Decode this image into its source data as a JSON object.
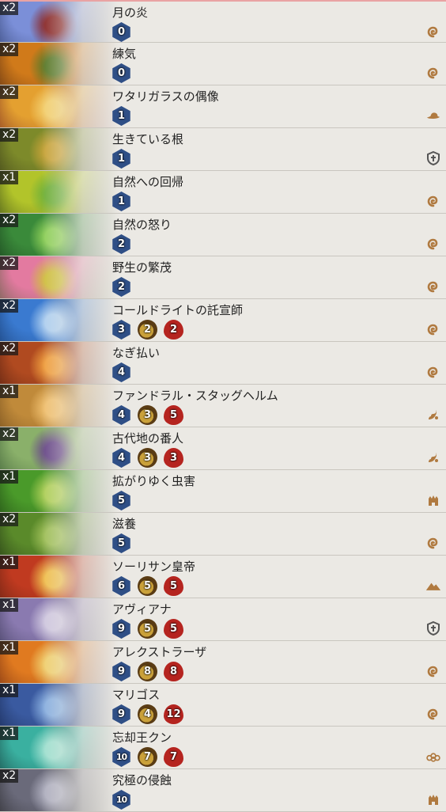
{
  "cards": [
    {
      "count": "x2",
      "name": "月の炎",
      "mana": "0",
      "attack": "",
      "health": "",
      "rarity": "free",
      "set_icon": "swirl-set-icon",
      "art": [
        "#1d2c55",
        "#7b8fd8",
        "#8b2a2a"
      ]
    },
    {
      "count": "x2",
      "name": "練気",
      "mana": "0",
      "attack": "",
      "health": "",
      "rarity": "free",
      "set_icon": "swirl-set-icon",
      "art": [
        "#3b1a10",
        "#d07a1a",
        "#5a7a2a"
      ]
    },
    {
      "count": "x2",
      "name": "ワタリガラスの偶像",
      "mana": "1",
      "attack": "",
      "health": "",
      "rarity": "free",
      "set_icon": "hat-set-icon",
      "art": [
        "#6a1a20",
        "#e4a030",
        "#f3d070"
      ]
    },
    {
      "count": "x2",
      "name": "生きている根",
      "mana": "1",
      "attack": "",
      "health": "",
      "rarity": "free",
      "set_icon": "shield-set-icon",
      "art": [
        "#2a2a14",
        "#7d8a2a",
        "#c9a43a"
      ]
    },
    {
      "count": "x1",
      "name": "自然への回帰",
      "mana": "1",
      "attack": "",
      "health": "",
      "rarity": "free",
      "set_icon": "swirl-set-icon",
      "art": [
        "#1f2f14",
        "#b2c42a",
        "#6fb03a"
      ]
    },
    {
      "count": "x2",
      "name": "自然の怒り",
      "mana": "2",
      "attack": "",
      "health": "",
      "rarity": "free",
      "set_icon": "swirl-set-icon",
      "art": [
        "#0f2a14",
        "#3a8a3a",
        "#8fd05a"
      ]
    },
    {
      "count": "x2",
      "name": "野生の繁茂",
      "mana": "2",
      "attack": "",
      "health": "",
      "rarity": "free",
      "set_icon": "swirl-set-icon",
      "art": [
        "#3a5a2a",
        "#e37aa0",
        "#d0c040"
      ]
    },
    {
      "count": "x2",
      "name": "コールドライトの託宣師",
      "mana": "3",
      "attack": "2",
      "health": "2",
      "rarity": "free",
      "set_icon": "swirl-set-icon",
      "art": [
        "#0e2a55",
        "#3a7ad0",
        "#b0d0f0"
      ]
    },
    {
      "count": "x2",
      "name": "なぎ払い",
      "mana": "4",
      "attack": "",
      "health": "",
      "rarity": "free",
      "set_icon": "swirl-set-icon",
      "art": [
        "#3a120c",
        "#b04a20",
        "#f0a040"
      ]
    },
    {
      "count": "x1",
      "name": "ファンドラル・スタッグヘルム",
      "mana": "4",
      "attack": "3",
      "health": "5",
      "rarity": "legendary",
      "set_icon": "dragon-set-icon",
      "art": [
        "#5a3a14",
        "#c08a3a",
        "#f0c070"
      ]
    },
    {
      "count": "x2",
      "name": "古代地の番人",
      "mana": "4",
      "attack": "3",
      "health": "3",
      "rarity": "free",
      "set_icon": "dragon-set-icon",
      "art": [
        "#2a4a2a",
        "#8ab06a",
        "#6a4a8a"
      ]
    },
    {
      "count": "x1",
      "name": "拡がりゆく虫害",
      "mana": "5",
      "attack": "",
      "health": "",
      "rarity": "free",
      "set_icon": "castle-set-icon",
      "art": [
        "#14300e",
        "#4a9a2a",
        "#b0d05a"
      ]
    },
    {
      "count": "x2",
      "name": "滋養",
      "mana": "5",
      "attack": "",
      "health": "",
      "rarity": "free",
      "set_icon": "swirl-set-icon",
      "art": [
        "#14200e",
        "#5a8a2a",
        "#a0c05a"
      ]
    },
    {
      "count": "x1",
      "name": "ソーリサン皇帝",
      "mana": "6",
      "attack": "5",
      "health": "5",
      "rarity": "legendary",
      "set_icon": "mountain-set-icon",
      "art": [
        "#4a1a0e",
        "#c03a20",
        "#f0c050"
      ]
    },
    {
      "count": "x1",
      "name": "アヴィアナ",
      "mana": "9",
      "attack": "5",
      "health": "5",
      "rarity": "legendary",
      "set_icon": "shield-set-icon",
      "art": [
        "#2a2a44",
        "#8a7ab0",
        "#d0c8e0"
      ]
    },
    {
      "count": "x1",
      "name": "アレクストラーザ",
      "mana": "9",
      "attack": "8",
      "health": "8",
      "rarity": "legendary",
      "set_icon": "swirl-set-icon",
      "art": [
        "#5a1a0e",
        "#e07a20",
        "#f0d070"
      ]
    },
    {
      "count": "x1",
      "name": "マリゴス",
      "mana": "9",
      "attack": "4",
      "health": "12",
      "rarity": "legendary",
      "set_icon": "swirl-set-icon",
      "art": [
        "#0e1a3a",
        "#3a5aa0",
        "#8ab0e0"
      ]
    },
    {
      "count": "x1",
      "name": "忘却王クン",
      "mana": "10",
      "attack": "7",
      "health": "7",
      "rarity": "legendary",
      "set_icon": "cloud-set-icon",
      "art": [
        "#0e2a2a",
        "#3ab0a0",
        "#a0e0d0"
      ]
    },
    {
      "count": "x2",
      "name": "究極の侵蝕",
      "mana": "10",
      "attack": "",
      "health": "",
      "rarity": "free",
      "set_icon": "castle-set-icon",
      "art": [
        "#1a1a1a",
        "#6a6a7a",
        "#b0b0c0"
      ]
    }
  ],
  "colors": {
    "background": "#ebe9e4",
    "divider": "#c9c6bf",
    "mana": "#2f4f86",
    "health": "#b5241f",
    "set_icon": "#b07a40",
    "top_accent": "#e9a3a3"
  }
}
